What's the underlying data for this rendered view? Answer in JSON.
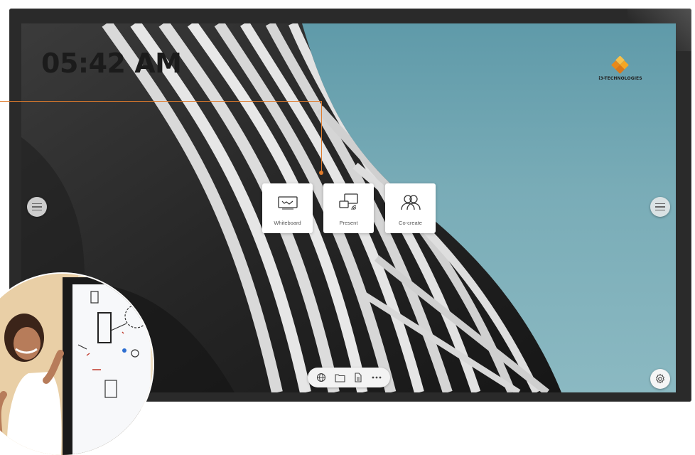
{
  "clock": {
    "time": "05:42 AM"
  },
  "brand": {
    "name": "i3-TECHNOLOGIES",
    "colors": [
      "#f5a623",
      "#e8891a",
      "#f7c04a"
    ]
  },
  "launchers": [
    {
      "label": "Whiteboard",
      "icon": "whiteboard-icon"
    },
    {
      "label": "Present",
      "icon": "present-icon"
    },
    {
      "label": "Co-create",
      "icon": "co-create-icon"
    }
  ],
  "dock": {
    "items": [
      {
        "icon": "globe-icon"
      },
      {
        "icon": "folder-icon"
      },
      {
        "icon": "document-icon"
      },
      {
        "icon": "more-icon"
      }
    ]
  },
  "side_menus": [
    {
      "icon": "menu-icon"
    },
    {
      "icon": "menu-icon"
    }
  ],
  "settings": {
    "icon": "settings-icon"
  },
  "accent": "#e07b2c"
}
